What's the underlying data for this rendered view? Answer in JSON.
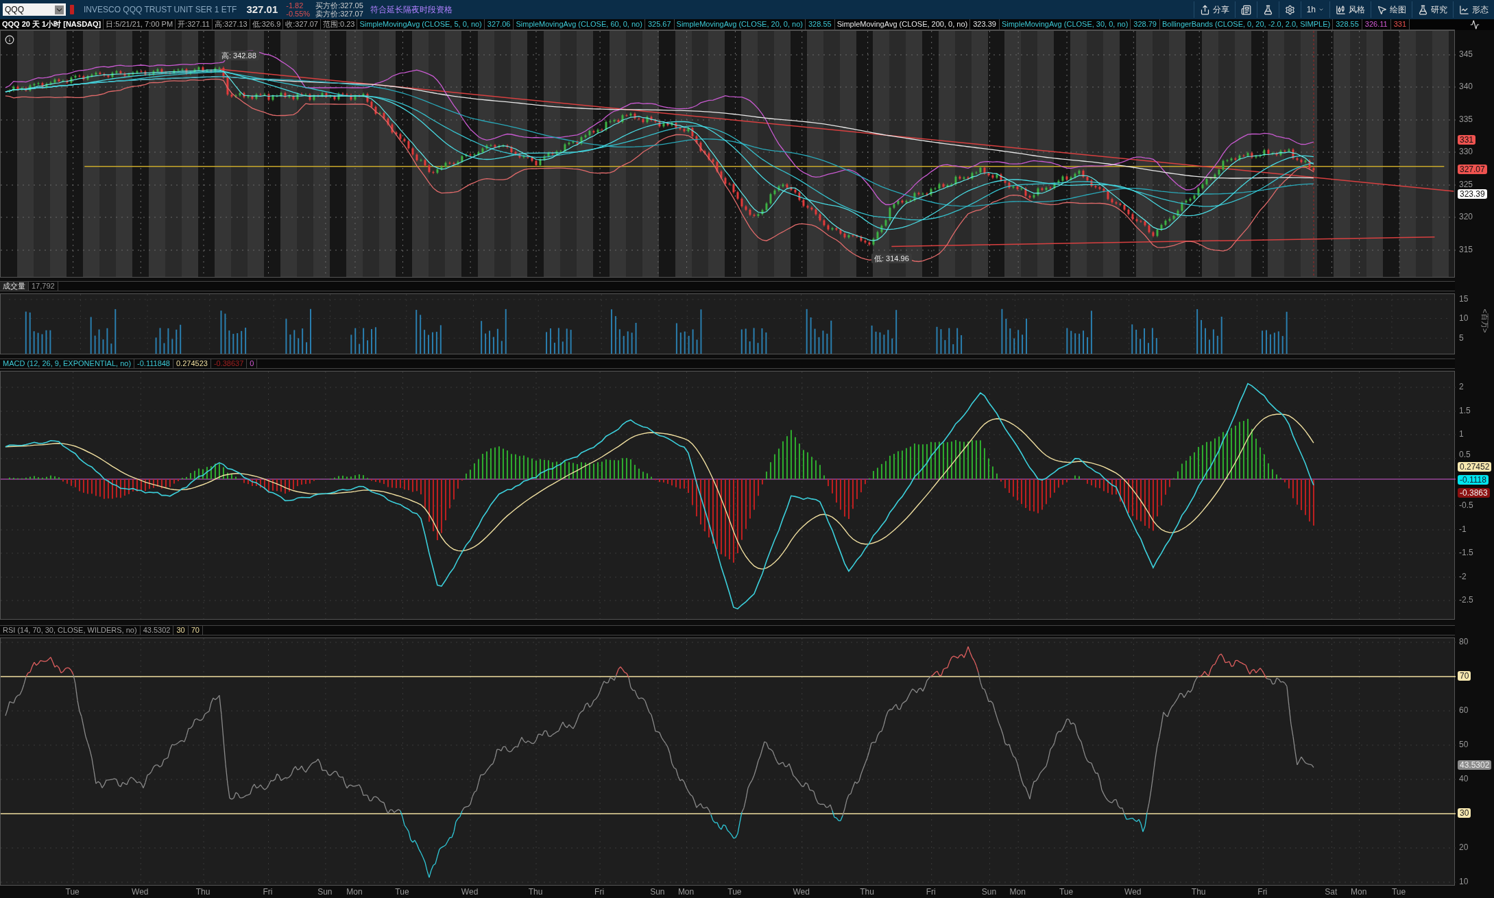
{
  "toolbar": {
    "symbol": "QQQ",
    "description": "INVESCO QQQ TRUST UNIT SER 1 ETF",
    "last": "327.01",
    "change": "-1.82",
    "change_pct": "-0.55%",
    "bid": "买方价:327.05",
    "ask": "卖方价:327.07",
    "extended_hours": "符合延长隔夜时段资格",
    "buttons": [
      {
        "kind": "share",
        "label": "分享"
      },
      {
        "kind": "news"
      },
      {
        "kind": "flask"
      },
      {
        "kind": "gear"
      },
      {
        "kind": "interval",
        "label": "1h"
      },
      {
        "kind": "style",
        "label": "风格"
      },
      {
        "kind": "draw",
        "label": "绘图"
      },
      {
        "kind": "flask",
        "label": "研究"
      },
      {
        "kind": "pattern",
        "label": "形态"
      }
    ]
  },
  "info_bar": {
    "title": "QQQ 20 天 1小时 [NASDAQ]",
    "fields": [
      "日:5/21/21, 7:00 PM",
      "开:327.11",
      "高:327.13",
      "低:326.9",
      "收:327.07",
      "范围:0.23"
    ],
    "studies": [
      {
        "label": "SimpleMovingAvg (CLOSE, 5, 0, no)",
        "kind": "study",
        "values": [
          {
            "text": "327.06",
            "kind": "main"
          }
        ]
      },
      {
        "label": "SimpleMovingAvg (CLOSE, 60, 0, no)",
        "kind": "study",
        "values": [
          {
            "text": "325.67",
            "kind": "main"
          }
        ]
      },
      {
        "label": "SimpleMovingAvg (CLOSE, 20, 0, no)",
        "kind": "study",
        "values": [
          {
            "text": "328.55",
            "kind": "main"
          }
        ]
      },
      {
        "label": "SimpleMovingAvg (CLOSE, 200, 0, no)",
        "kind": "long",
        "values": [
          {
            "text": "323.39",
            "kind": "long"
          }
        ]
      },
      {
        "label": "SimpleMovingAvg (CLOSE, 30, 0, no)",
        "kind": "study",
        "values": [
          {
            "text": "328.79",
            "kind": "main"
          }
        ]
      },
      {
        "label": "BollingerBands (CLOSE, 0, 20, -2.0, 2.0, SIMPLE)",
        "kind": "study",
        "values": [
          {
            "text": "328.55",
            "kind": "main"
          },
          {
            "text": "326.11",
            "kind": "lower"
          },
          {
            "text": "331",
            "kind": "upper"
          }
        ]
      }
    ]
  },
  "price_pane": {
    "ticks": [
      "345",
      "340",
      "335",
      "330",
      "325",
      "320",
      "315"
    ],
    "markers": [
      {
        "text": "331",
        "color": "#ef5350"
      },
      {
        "text": "327.07",
        "color": "#ef5350"
      },
      {
        "text": "323.39",
        "color": "#ffffff"
      }
    ],
    "high_label": "高: 342.88",
    "low_label": "低: 314.96"
  },
  "volume_pane": {
    "title": "成交量",
    "value": "17,792",
    "ticks": [
      "15",
      "10",
      "5"
    ],
    "unit": "<百万>"
  },
  "macd_pane": {
    "title": "MACD (12, 26, 9, EXPONENTIAL, no)",
    "values": [
      {
        "text": "-0.111848",
        "kind": "main"
      },
      {
        "text": "0.274523",
        "kind": "signal"
      },
      {
        "text": "-0.38637",
        "kind": "diff"
      },
      {
        "text": "0",
        "kind": "zero"
      }
    ],
    "ticks": [
      "2",
      "1.5",
      "1",
      "0.5",
      "-0.5",
      "-1",
      "-1.5",
      "-2",
      "-2.5"
    ],
    "markers": [
      {
        "text": "0.27452",
        "color": "#f8e8b0"
      },
      {
        "text": "-0.1118",
        "color": "#00e5ee"
      },
      {
        "text": "-0.3863",
        "color": "#8b1010"
      }
    ]
  },
  "rsi_pane": {
    "title": "RSI (14, 70, 30, CLOSE, WILDERS, no)",
    "values": [
      {
        "text": "43.5302",
        "kind": "plain"
      },
      {
        "text": "30",
        "kind": "signal"
      },
      {
        "text": "70",
        "kind": "signal"
      }
    ],
    "ticks": [
      "80",
      "60",
      "50",
      "40",
      "20",
      "10"
    ],
    "markers": [
      {
        "text": "70",
        "color": "#f8e8b0"
      },
      {
        "text": "43.5302",
        "color": "#8a8a8a"
      },
      {
        "text": "30",
        "color": "#f8e8b0"
      }
    ]
  },
  "x_axis": [
    "Tue",
    "Wed",
    "Thu",
    "Fri",
    "Sun",
    "Mon",
    "Tue",
    "Wed",
    "Thu",
    "Fri",
    "Sun",
    "Mon",
    "Tue",
    "Wed",
    "Thu",
    "Fri",
    "Sun",
    "Mon",
    "Tue",
    "Wed",
    "Thu",
    "Fri",
    "Sat",
    "Mon",
    "Tue"
  ]
}
